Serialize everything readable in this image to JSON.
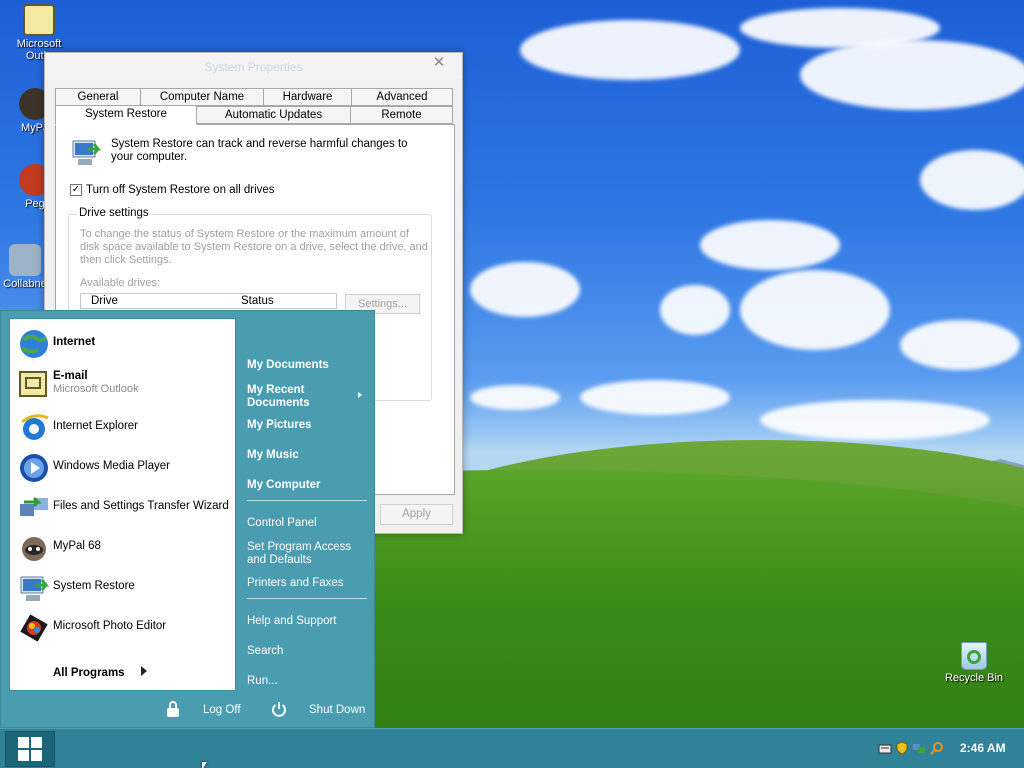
{
  "desktop": {
    "icons": [
      {
        "label": "Microsoft\nOutlo",
        "icon": "outlook-icon"
      },
      {
        "label": "MyPa",
        "icon": "mypal-icon"
      },
      {
        "label": "Peg",
        "icon": "pegasus-icon"
      },
      {
        "label": "Collabne",
        "icon": "collabnet-icon"
      },
      {
        "label": "Recycle Bin",
        "icon": "recycle-bin-icon"
      }
    ]
  },
  "system_properties": {
    "title": "System Properties",
    "close_glyph": "✕",
    "tabs_back": [
      "General",
      "Computer Name",
      "Hardware",
      "Advanced"
    ],
    "tabs_front": [
      "System Restore",
      "Automatic Updates",
      "Remote"
    ],
    "active_tab": "System Restore",
    "description": "System Restore can track and reverse harmful changes to your computer.",
    "turn_off_label": "Turn off System Restore on all drives",
    "turn_off_checked": true,
    "checkmark_glyph": "✓",
    "drive_settings_legend": "Drive settings",
    "drive_settings_help": "To change the status of System Restore or the maximum amount of disk space available to System Restore on a drive, select the drive, and then click Settings.",
    "available_drives_label": "Available drives:",
    "columns": [
      "Drive",
      "Status"
    ],
    "settings_button": "Settings...",
    "apply_button": "Apply"
  },
  "start_menu": {
    "pinned": [
      {
        "title": "Internet",
        "subtitle": "",
        "bold": true,
        "icon": "internet-globe-icon"
      },
      {
        "title": "E-mail",
        "subtitle": "Microsoft Outlook",
        "bold": true,
        "icon": "outlook-icon"
      },
      {
        "title": "Internet Explorer",
        "subtitle": "",
        "bold": false,
        "icon": "internet-explorer-icon"
      },
      {
        "title": "Windows Media Player",
        "subtitle": "",
        "bold": false,
        "icon": "media-player-icon"
      },
      {
        "title": "Files and Settings Transfer Wizard",
        "subtitle": "",
        "bold": false,
        "icon": "transfer-wizard-icon"
      },
      {
        "title": "MyPal 68",
        "subtitle": "",
        "bold": false,
        "icon": "mypal-icon"
      },
      {
        "title": "System Restore",
        "subtitle": "",
        "bold": false,
        "icon": "system-restore-icon"
      },
      {
        "title": "Microsoft Photo Editor",
        "subtitle": "",
        "bold": false,
        "icon": "photo-editor-icon"
      }
    ],
    "all_programs": "All Programs",
    "right": {
      "my_documents": "My Documents",
      "my_recent_documents": "My Recent\nDocuments",
      "my_pictures": "My Pictures",
      "my_music": "My Music",
      "my_computer": "My Computer",
      "control_panel": "Control Panel",
      "set_program_access": "Set Program Access\nand Defaults",
      "printers_and_faxes": "Printers and Faxes",
      "help_and_support": "Help and Support",
      "search": "Search",
      "run": "Run..."
    },
    "log_off": "Log Off",
    "shut_down": "Shut Down"
  },
  "taskbar": {
    "clock": "2:46 AM",
    "tray_icons": [
      "keyboard-icon",
      "security-shield-icon",
      "network-icon",
      "search-icon"
    ]
  },
  "colors": {
    "start_menu_bg": "#4a9db0",
    "taskbar_bg": "#2f8298",
    "window_bg": "#f0f0f0"
  }
}
